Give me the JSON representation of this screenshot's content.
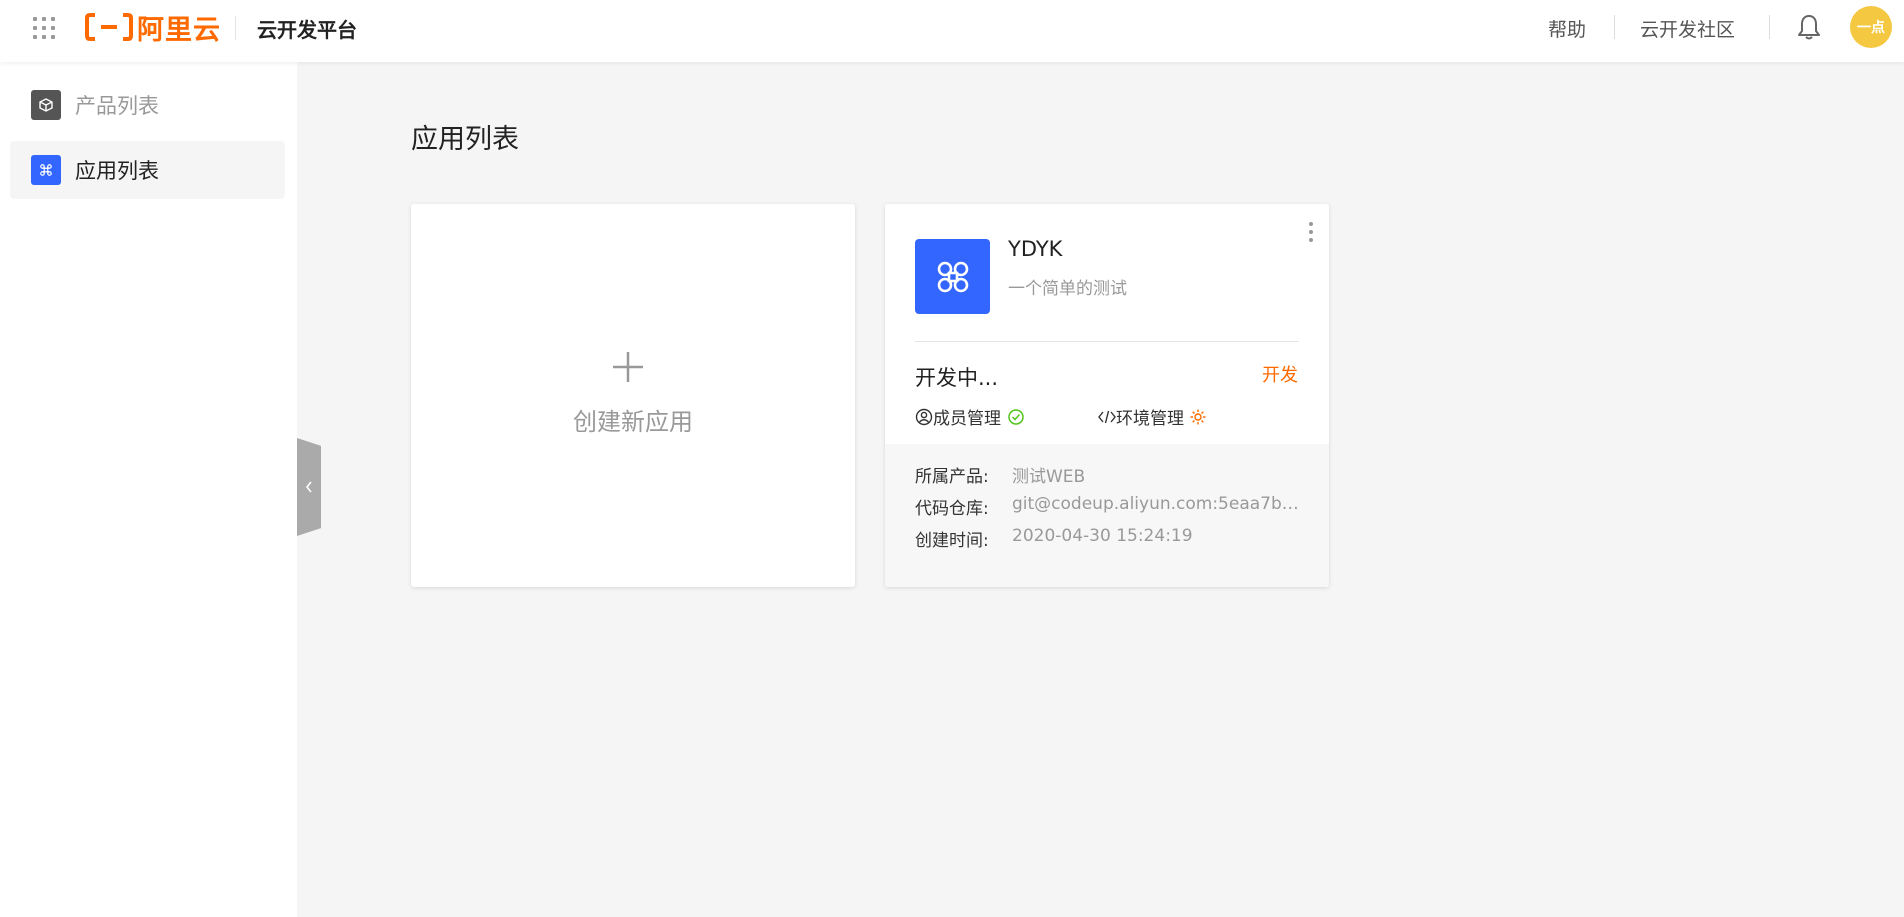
{
  "header": {
    "logo_text": "阿里云",
    "platform_title": "云开发平台",
    "help_label": "帮助",
    "community_label": "云开发社区",
    "avatar_text": "一点"
  },
  "sidebar": {
    "items": [
      {
        "label": "产品列表",
        "icon": "cube-icon",
        "active": false,
        "icon_color": "#555555"
      },
      {
        "label": "应用列表",
        "icon": "command-icon",
        "active": true,
        "icon_color": "#3366ff"
      }
    ]
  },
  "main": {
    "page_title": "应用列表",
    "create_card": {
      "label": "创建新应用"
    },
    "apps": [
      {
        "name": "YDYK",
        "description": "一个简单的测试",
        "status": "开发中...",
        "action_label": "开发",
        "member_mgmt_label": "成员管理",
        "env_mgmt_label": "环境管理",
        "info": [
          {
            "label": "所属产品:",
            "value": "测试WEB"
          },
          {
            "label": "代码仓库:",
            "value": "git@codeup.aliyun.com:5eaa7be…"
          },
          {
            "label": "创建时间:",
            "value": "2020-04-30 15:24:19"
          }
        ]
      }
    ]
  },
  "colors": {
    "brand": "#ff6a00",
    "accent_blue": "#3366ff",
    "success_green": "#52c41a",
    "avatar_yellow": "#f5c842"
  }
}
